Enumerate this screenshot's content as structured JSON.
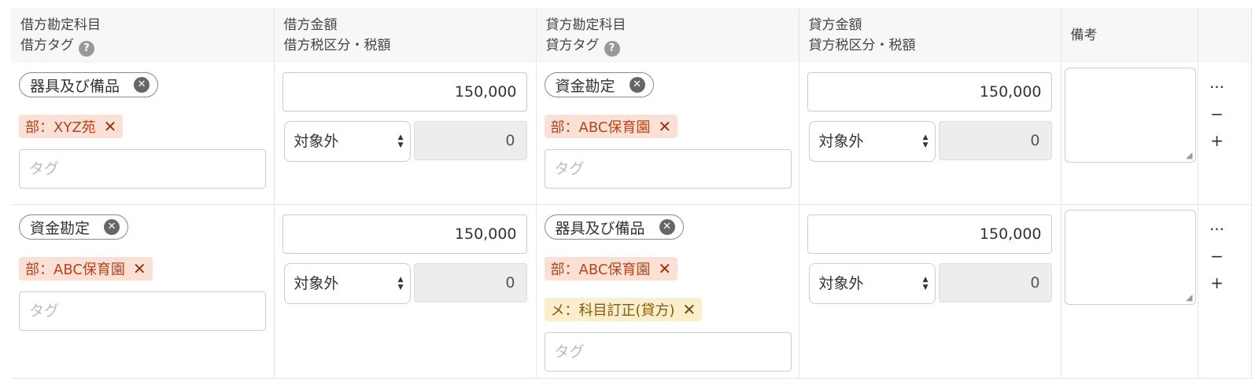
{
  "header": {
    "debit_account": "借方勘定科目",
    "debit_tag": "借方タグ",
    "debit_amount": "借方金額",
    "debit_tax": "借方税区分・税額",
    "credit_account": "貸方勘定科目",
    "credit_tag": "貸方タグ",
    "credit_amount": "貸方金額",
    "credit_tax": "貸方税区分・税額",
    "note": "備考",
    "help_glyph": "?"
  },
  "tag_placeholder": "タグ",
  "ops": {
    "more": "···",
    "remove": "−",
    "add": "+"
  },
  "rows": [
    {
      "debit": {
        "account": "器具及び備品",
        "tags": [
          {
            "label": "部：XYZ苑",
            "kind": "dept"
          }
        ],
        "amount": "150,000",
        "tax_category": "対象外",
        "tax_amount": "0"
      },
      "credit": {
        "account": "資金勘定",
        "tags": [
          {
            "label": "部：ABC保育園",
            "kind": "dept"
          }
        ],
        "amount": "150,000",
        "tax_category": "対象外",
        "tax_amount": "0"
      },
      "note": ""
    },
    {
      "debit": {
        "account": "資金勘定",
        "tags": [
          {
            "label": "部：ABC保育園",
            "kind": "dept"
          }
        ],
        "amount": "150,000",
        "tax_category": "対象外",
        "tax_amount": "0"
      },
      "credit": {
        "account": "器具及び備品",
        "tags": [
          {
            "label": "部：ABC保育園",
            "kind": "dept"
          },
          {
            "label": "メ：科目訂正(貸方)",
            "kind": "memo"
          }
        ],
        "amount": "150,000",
        "tax_category": "対象外",
        "tax_amount": "0"
      },
      "note": ""
    }
  ],
  "colors": {
    "dept_tag_bg": "#fbe0d5",
    "dept_tag_text": "#b5451b",
    "memo_tag_bg": "#fbeecc",
    "memo_tag_text": "#8a5a0a",
    "header_bg": "#f7f7f7"
  }
}
